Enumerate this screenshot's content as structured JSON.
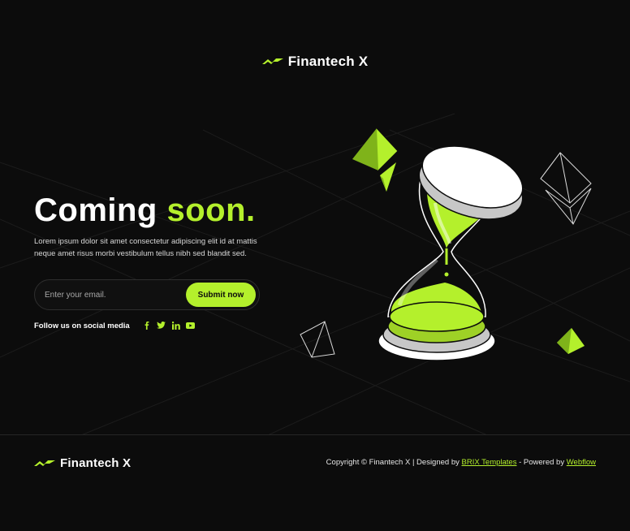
{
  "brand": {
    "name": "Finantech X",
    "accent_color": "#b4f02c",
    "logo_icon": "finantech-logo-icon"
  },
  "hero": {
    "title": "Coming",
    "title_accent": "soon.",
    "description": "Lorem ipsum dolor sit amet consectetur adipiscing elit id at mattis neque amet risus morbi vestibulum tellus nibh sed blandit sed."
  },
  "form": {
    "email_placeholder": "Enter your email.",
    "submit_label": "Submit now"
  },
  "social": {
    "label": "Follow us on social media",
    "icons": [
      "facebook-icon",
      "twitter-icon",
      "linkedin-icon",
      "youtube-icon"
    ]
  },
  "footer": {
    "copyright_prefix": "Copyright © Finantech X | Designed by",
    "designer_link": "BRIX Templates",
    "powered_text": "- Powered by",
    "platform_link": "Webflow"
  },
  "illustration": {
    "icon": "hourglass-icon",
    "decor": [
      "ethereum-crystal-green-icon",
      "ethereum-crystal-outline-icon",
      "pyramid-outline-icon",
      "pyramid-green-icon"
    ]
  }
}
